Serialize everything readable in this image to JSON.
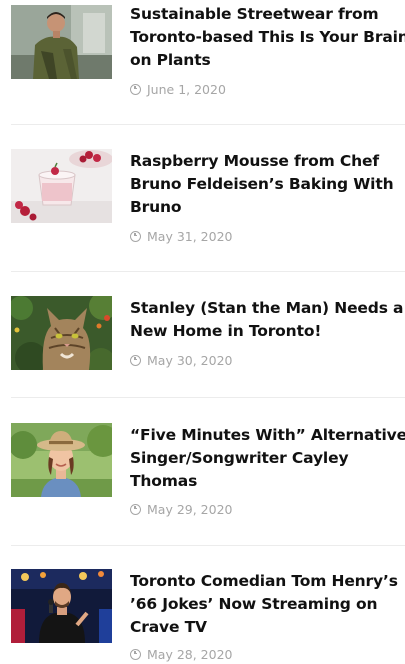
{
  "articles": [
    {
      "title": "Sustainable Streetwear from Toronto-based This Is Your Brain on Plants",
      "date": "June 1, 2020",
      "thumbnail_icon": "man-outdoors-photo"
    },
    {
      "title": "Raspberry Mousse from Chef Bruno Feldeisen’s Baking With Bruno",
      "date": "May 31, 2020",
      "thumbnail_icon": "raspberry-dessert-photo"
    },
    {
      "title": "Stanley (Stan the Man) Needs a New Home in Toronto!",
      "date": "May 30, 2020",
      "thumbnail_icon": "tabby-cat-photo"
    },
    {
      "title": "“Five Minutes With” Alternative Singer/Songwriter Cayley Thomas",
      "date": "May 29, 2020",
      "thumbnail_icon": "woman-in-hat-photo"
    },
    {
      "title": "Toronto Comedian Tom Henry’s ’66 Jokes’ Now Streaming on Crave TV",
      "date": "May 28, 2020",
      "thumbnail_icon": "comedian-on-stage-photo"
    }
  ]
}
